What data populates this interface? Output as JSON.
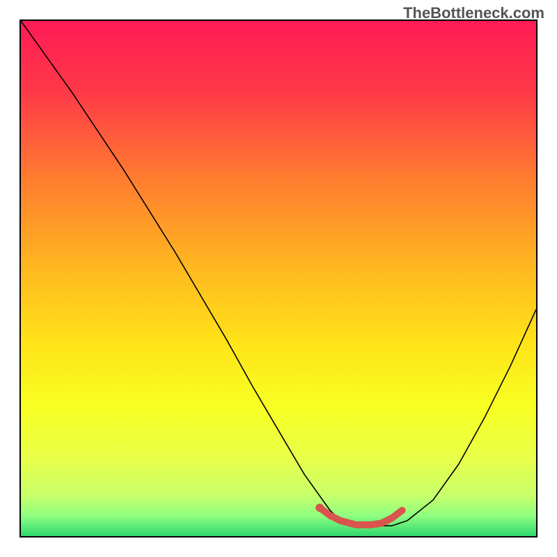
{
  "watermark": "TheBottleneck.com",
  "chart_data": {
    "type": "line",
    "title": "",
    "xlabel": "",
    "ylabel": "",
    "xlim": [
      0,
      100
    ],
    "ylim": [
      0,
      100
    ],
    "legend": false,
    "grid": false,
    "background_gradient": [
      "#ff1a55",
      "#ff4d40",
      "#ff9030",
      "#ffd020",
      "#faff20",
      "#e0ff50",
      "#a0ff70",
      "#30e070"
    ],
    "series": [
      {
        "name": "curve",
        "color": "#000000",
        "x": [
          0,
          5,
          10,
          15,
          20,
          25,
          30,
          35,
          40,
          45,
          50,
          55,
          60,
          62,
          65,
          68,
          72,
          75,
          80,
          85,
          90,
          95,
          100
        ],
        "y": [
          100,
          93,
          86,
          78.5,
          71,
          63,
          55,
          46.5,
          38,
          29,
          20.5,
          12,
          5,
          3,
          2,
          2,
          2,
          3,
          7,
          14,
          23,
          33,
          44
        ]
      },
      {
        "name": "highlight",
        "color": "#d9544d",
        "x": [
          58,
          60,
          62,
          65,
          68,
          70,
          72,
          74
        ],
        "y": [
          5.5,
          4,
          3,
          2.2,
          2.2,
          2.5,
          3.5,
          5
        ]
      }
    ],
    "markers": [
      {
        "name": "highlight-start-dot",
        "x": 58,
        "y": 5.5,
        "color": "#d9544d",
        "r": 6
      }
    ]
  }
}
